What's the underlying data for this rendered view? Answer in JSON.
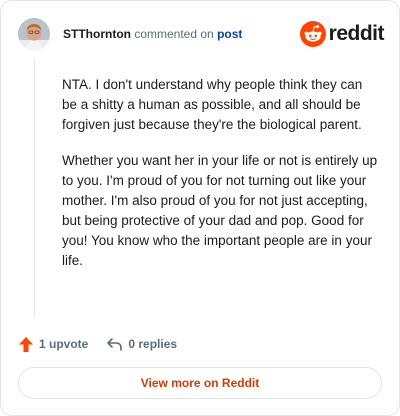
{
  "header": {
    "author": "STThornton",
    "action": "commented on",
    "post_link": "post",
    "brand": "reddit"
  },
  "comment": {
    "paragraphs": [
      "NTA. I don't understand why people think they can be a shitty a human as possible, and all should be forgiven just because they're the biological parent.",
      "Whether you want her in your life or not is entirely up to you. I'm proud of you for not turning out like your mother. I'm also proud of you for not just accepting, but being protective of your dad and pop. Good for you! You know who the important people are in your life."
    ]
  },
  "footer": {
    "upvotes": "1 upvote",
    "replies": "0 replies"
  },
  "cta": {
    "label": "View more on Reddit"
  },
  "colors": {
    "brand_orange": "#ff4500",
    "cta_text": "#d93a00",
    "link": "#0a449b"
  },
  "icons": {
    "upvote": "upvote-arrow-icon",
    "reply": "reply-arrow-icon",
    "brand": "reddit-alien-icon"
  }
}
